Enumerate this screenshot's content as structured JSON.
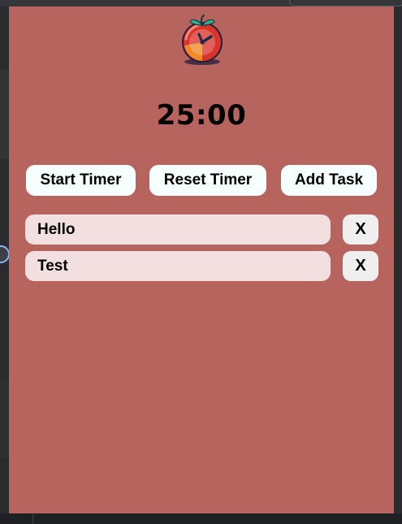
{
  "logo": {
    "icon": "tomato-clock-icon"
  },
  "timer": {
    "display": "25:00"
  },
  "controls": {
    "start_label": "Start Timer",
    "reset_label": "Reset Timer",
    "add_label": "Add Task"
  },
  "tasks": [
    {
      "text": "Hello",
      "delete_label": "X"
    },
    {
      "text": "Test",
      "delete_label": "X"
    }
  ],
  "colors": {
    "panel": "#b8645e",
    "button": "#f6fffe",
    "task_bg": "#f2dfe0",
    "delete_bg": "#efefef"
  }
}
